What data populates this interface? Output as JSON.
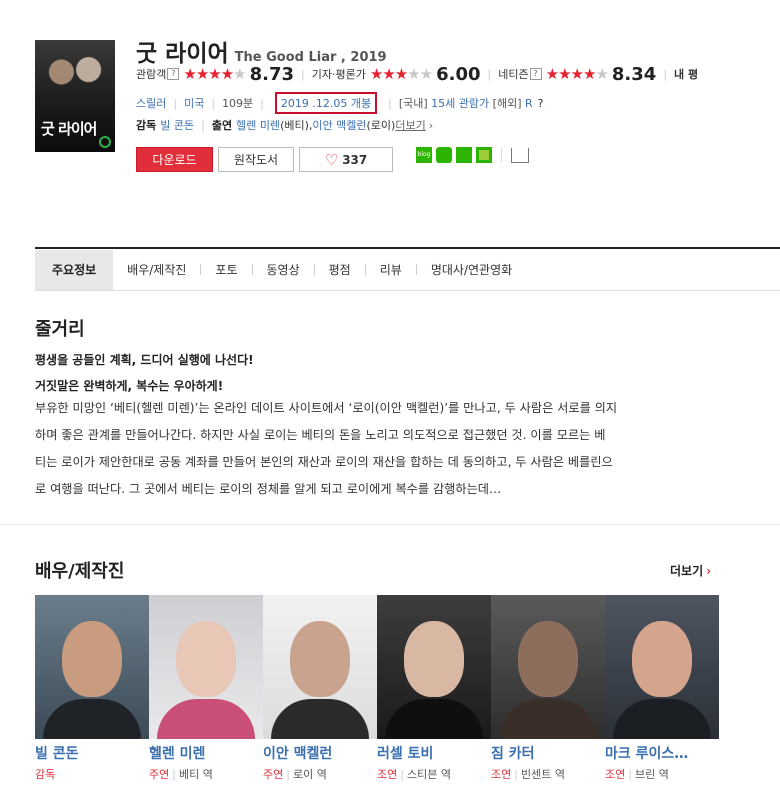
{
  "movie": {
    "title": "굿 라이어",
    "subtitle": "The Good Liar , 2019",
    "poster_title": "굿 라이어"
  },
  "ratings": {
    "audience_label": "관람객",
    "audience_score": "8.73",
    "audience_stars": 4.5,
    "critic_label": "기자·평론가",
    "critic_score": "6.00",
    "critic_stars": 3,
    "netizen_label": "네티즌",
    "netizen_score": "8.34",
    "netizen_stars": 4.5,
    "mine_label": "내 평",
    "help_mark": "?"
  },
  "info": {
    "genre": "스릴러",
    "country": "미국",
    "runtime": "109분",
    "release": "2019 .12.05 개봉",
    "domestic_label": "[국내]",
    "domestic_rating": "15세 관람가",
    "overseas_label": "[해외]",
    "overseas_rating": "R"
  },
  "credits": {
    "director_label": "감독",
    "director": "빌 콘돈",
    "cast_label": "출연",
    "cast": "헬렌 미렌",
    "cast_role1": "(베티), ",
    "cast2": "이안 맥켈런",
    "cast_role2": "(로이)",
    "more": "더보기",
    "more_chev": "›"
  },
  "buttons": {
    "download": "다운로드",
    "book": "원작도서",
    "like_count": "337",
    "blog_icon_text": "blog"
  },
  "tabs": [
    "주요정보",
    "배우/제작진",
    "포토",
    "동영상",
    "평점",
    "리뷰",
    "명대사/연관영화"
  ],
  "synopsis": {
    "heading": "줄거리",
    "tagline1": "평생을 공들인 계획, 드디어 실행에 나선다!",
    "tagline2": "거짓말은 완벽하게, 복수는 우아하게!",
    "lines": [
      "부유한 미망인 ‘베티(헬렌 미렌)’는 온라인 데이트 사이트에서 ‘로이(이안 맥켈런)’를 만나고, 두 사람은 서로를 의지",
      "하며 좋은 관계를 만들어나간다. 하지만 사실 로이는 베티의 돈을 노리고 의도적으로 접근했던 것. 이를 모르는 베",
      "티는 로이가 제안한대로 공동 계좌를 만들어 본인의 재산과 로이의 재산을 합하는 데 동의하고, 두 사람은 베를린으",
      "로 여행을 떠난다. 그 곳에서 베티는 로이의 정체를 알게 되고 로이에게 복수를 감행하는데…"
    ]
  },
  "cast_section": {
    "heading": "배우/제작진",
    "more": "더보기",
    "chev": "›",
    "people": [
      {
        "name": "빌 콘돈",
        "role": "감독",
        "character": ""
      },
      {
        "name": "헬렌 미렌",
        "role": "주연",
        "character": "베티 역"
      },
      {
        "name": "이안 맥켈런",
        "role": "주연",
        "character": "로이 역"
      },
      {
        "name": "러셀 토비",
        "role": "조연",
        "character": "스티븐 역"
      },
      {
        "name": "짐 카터",
        "role": "조연",
        "character": "빈센트 역"
      },
      {
        "name": "마크 루이스…",
        "role": "조연",
        "character": "브린 역"
      }
    ]
  },
  "colors": {
    "accent_red": "#e02f3a",
    "link_blue": "#3a6fb0",
    "highlight_box": "#c8102e"
  }
}
